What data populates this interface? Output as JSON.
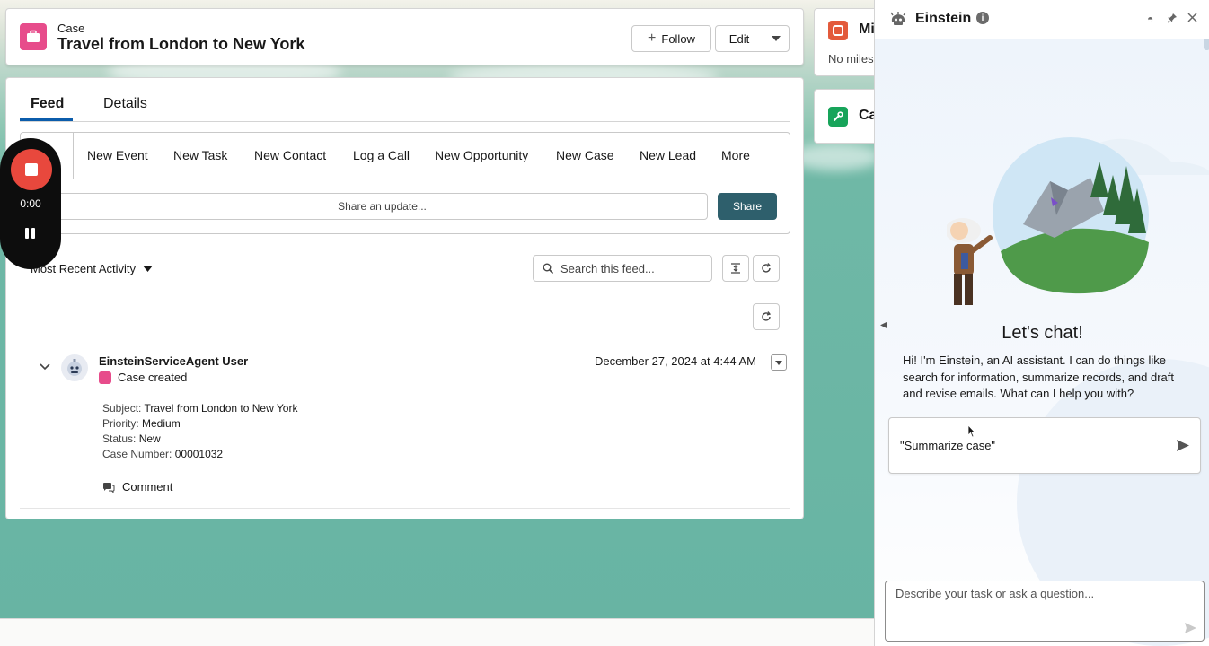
{
  "header": {
    "object_type": "Case",
    "title": "Travel from London to New York",
    "follow_label": "Follow",
    "edit_label": "Edit"
  },
  "side_cards": {
    "milestones_title": "Mi",
    "milestones_sub": "No miles",
    "second_title": "Ca"
  },
  "tabs": [
    {
      "label": "Feed",
      "active": true
    },
    {
      "label": "Details",
      "active": false
    }
  ],
  "publisher": {
    "actions": [
      "New Event",
      "New Task",
      "New Contact",
      "Log a Call",
      "New Opportunity",
      "New Case",
      "New Lead",
      "More"
    ],
    "share_placeholder": "Share an update...",
    "share_button": "Share"
  },
  "recording": {
    "time": "0:00"
  },
  "feed_controls": {
    "sort_label": "Most Recent Activity",
    "search_placeholder": "Search this feed..."
  },
  "feed_item": {
    "author": "EinsteinServiceAgent User",
    "action": "Case created",
    "timestamp": "December 27, 2024 at 4:44 AM",
    "fields": [
      {
        "label": "Subject:",
        "value": "Travel from London to New York"
      },
      {
        "label": "Priority:",
        "value": "Medium"
      },
      {
        "label": "Status:",
        "value": "New"
      },
      {
        "label": "Case Number:",
        "value": "00001032"
      }
    ],
    "comment_label": "Comment"
  },
  "einstein": {
    "title": "Einstein",
    "chat_title": "Let's chat!",
    "intro": "Hi! I'm Einstein, an AI assistant. I can do things like search for information, summarize records, and draft and revise emails. What can I help you with?",
    "suggestion": "\"Summarize case\"",
    "input_placeholder": "Describe your task or ask a question..."
  },
  "colors": {
    "case_icon": "#e74c8b",
    "share_button": "#2e5f6c",
    "tab_underline": "#0b5cab",
    "record_button": "#e8483d"
  }
}
